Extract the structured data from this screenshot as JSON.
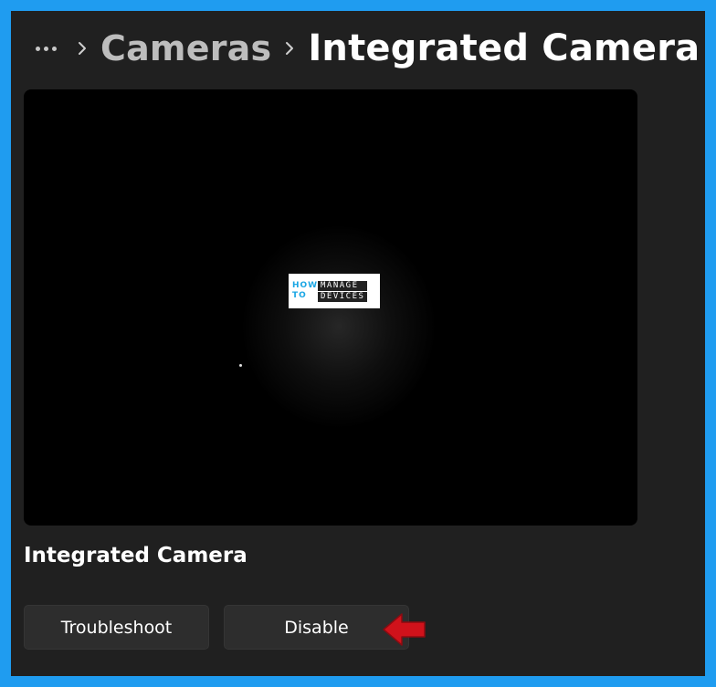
{
  "breadcrumb": {
    "parent": "Cameras",
    "current": "Integrated Camera"
  },
  "watermark": {
    "left_top": "HOW",
    "left_bottom": "TO",
    "right_top": "MANAGE",
    "right_bottom": "DEVICES"
  },
  "device": {
    "name": "Integrated Camera"
  },
  "actions": {
    "troubleshoot_label": "Troubleshoot",
    "disable_label": "Disable"
  },
  "colors": {
    "frame_border": "#1f9cf0",
    "panel_background": "#202020",
    "button_background": "#2d2d2d",
    "annotation_arrow": "#d0121b",
    "logo_accent": "#1aa6e4"
  },
  "icons": {
    "more": "more-icon",
    "chevron": "chevron-right-icon",
    "annotation": "red-arrow-icon"
  }
}
